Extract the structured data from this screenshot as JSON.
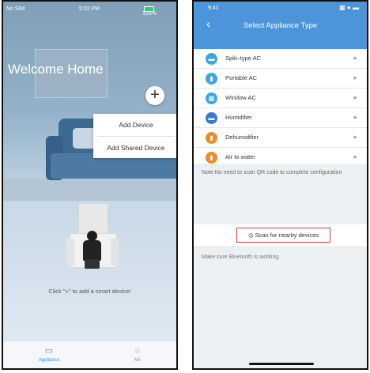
{
  "left_screen": {
    "status": {
      "carrier": "No SIM",
      "time": "5:02 PM",
      "battery": "100%"
    },
    "welcome": "Welcome Home",
    "add_button": "+",
    "menu": {
      "add_device": "Add Device",
      "add_shared": "Add Shared Device"
    },
    "hint": "Click \"+\" to add a smart device!",
    "tabs": [
      {
        "label": "Appliance",
        "icon": "device-icon"
      },
      {
        "label": "Me",
        "icon": "person-icon"
      }
    ]
  },
  "right_screen": {
    "status": {
      "time": "9:41"
    },
    "title": "Select Appliance Type",
    "items": [
      {
        "label": "Split–type AC",
        "icon": "split-ac-icon",
        "color": "#3aa6e8"
      },
      {
        "label": "Portable AC",
        "icon": "portable-ac-icon",
        "color": "#3aa6e8"
      },
      {
        "label": "Window AC",
        "icon": "window-ac-icon",
        "color": "#3aa6e8"
      },
      {
        "label": "Humidifier",
        "icon": "humidifier-icon",
        "color": "#3a78d6"
      },
      {
        "label": "Dehumidifier",
        "icon": "dehumidifier-icon",
        "color": "#f08a22"
      },
      {
        "label": "Air to water",
        "icon": "air-to-water-icon",
        "color": "#f08a22"
      }
    ],
    "note": "Note:No need to scan QR code to complete configuration",
    "scan_button": "Scan for nearby devices",
    "bluetooth_note": "Make sure Bluetooth is working.",
    "colors": {
      "header_blue": "#4d95db",
      "highlight_red": "#d43c3c"
    }
  }
}
